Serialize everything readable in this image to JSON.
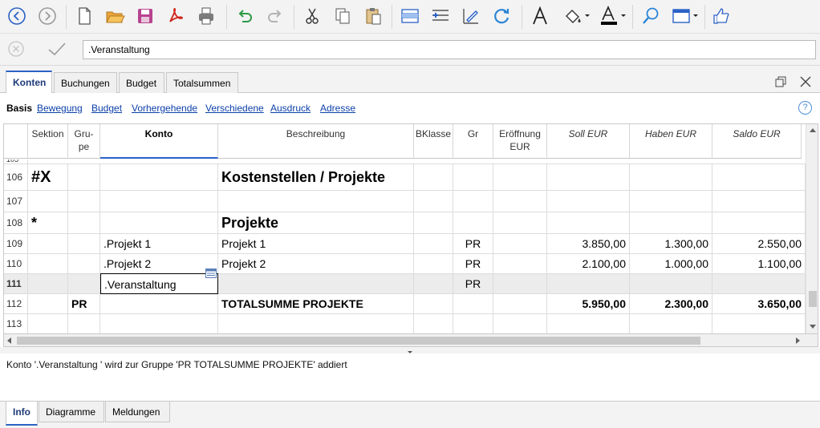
{
  "formula_bar": {
    "value": ".Veranstaltung"
  },
  "tabs": [
    {
      "label": "Konten",
      "active": true
    },
    {
      "label": "Buchungen"
    },
    {
      "label": "Budget"
    },
    {
      "label": "Totalsummen"
    }
  ],
  "views": [
    {
      "label": "Basis",
      "active": true
    },
    {
      "label": "Bewegung"
    },
    {
      "label": "Budget"
    },
    {
      "label": "Vorhergehende"
    },
    {
      "label": "Verschiedene"
    },
    {
      "label": "Ausdruck"
    },
    {
      "label": "Adresse"
    }
  ],
  "help_label": "?",
  "table": {
    "columns": [
      "",
      "Sektion",
      "Gru-\npe",
      "Konto",
      "Beschreibung",
      "BKlasse",
      "Gr",
      "Eröffnung\nEUR",
      "Soll EUR",
      "Haben EUR",
      "Saldo EUR"
    ],
    "partial_row_label": "105",
    "rows": [
      {
        "n": "106",
        "sektion": "#X",
        "gruppe": "",
        "konto": "",
        "beschreibung": "Kostenstellen / Projekte",
        "bklasse": "",
        "gr": "",
        "eroeffnung": "",
        "soll": "",
        "haben": "",
        "saldo": ""
      },
      {
        "n": "107",
        "sektion": "",
        "gruppe": "",
        "konto": "",
        "beschreibung": "",
        "bklasse": "",
        "gr": "",
        "eroeffnung": "",
        "soll": "",
        "haben": "",
        "saldo": ""
      },
      {
        "n": "108",
        "sektion": "*",
        "gruppe": "",
        "konto": "",
        "beschreibung": "Projekte",
        "bklasse": "",
        "gr": "",
        "eroeffnung": "",
        "soll": "",
        "haben": "",
        "saldo": ""
      },
      {
        "n": "109",
        "sektion": "",
        "gruppe": "",
        "konto": ".Projekt 1",
        "beschreibung": "Projekt 1",
        "bklasse": "",
        "gr": "PR",
        "eroeffnung": "",
        "soll": "3.850,00",
        "haben": "1.300,00",
        "saldo": "2.550,00"
      },
      {
        "n": "110",
        "sektion": "",
        "gruppe": "",
        "konto": ".Projekt 2",
        "beschreibung": "Projekt 2",
        "bklasse": "",
        "gr": "PR",
        "eroeffnung": "",
        "soll": "2.100,00",
        "haben": "1.000,00",
        "saldo": "1.100,00"
      },
      {
        "n": "111",
        "sektion": "",
        "gruppe": "",
        "konto": ".Veranstaltung",
        "beschreibung": "",
        "bklasse": "",
        "gr": "PR",
        "eroeffnung": "",
        "soll": "",
        "haben": "",
        "saldo": ""
      },
      {
        "n": "112",
        "sektion": "",
        "gruppe": "PR",
        "konto": "",
        "beschreibung": "TOTALSUMME PROJEKTE",
        "bklasse": "",
        "gr": "",
        "eroeffnung": "",
        "soll": "5.950,00",
        "haben": "2.300,00",
        "saldo": "3.650,00"
      },
      {
        "n": "113",
        "sektion": "",
        "gruppe": "",
        "konto": "",
        "beschreibung": "",
        "bklasse": "",
        "gr": "",
        "eroeffnung": "",
        "soll": "",
        "haben": "",
        "saldo": ""
      }
    ]
  },
  "message": "Konto '.Veranstaltung ' wird zur Gruppe 'PR TOTALSUMME PROJEKTE' addiert",
  "bottom_tabs": [
    {
      "label": "Info",
      "active": true
    },
    {
      "label": "Diagramme"
    },
    {
      "label": "Meldungen"
    }
  ],
  "toolbar_icons": [
    "back-icon",
    "forward-icon",
    "new-file-icon",
    "open-folder-icon",
    "save-icon",
    "pdf-icon",
    "print-icon",
    "undo-icon",
    "redo-icon",
    "cut-icon",
    "copy-icon",
    "paste-icon",
    "insert-row-icon",
    "add-rows-icon",
    "edit-icon",
    "recalculate-icon",
    "font-icon",
    "fill-color-icon",
    "text-color-icon",
    "find-icon",
    "window-icon",
    "like-icon"
  ]
}
